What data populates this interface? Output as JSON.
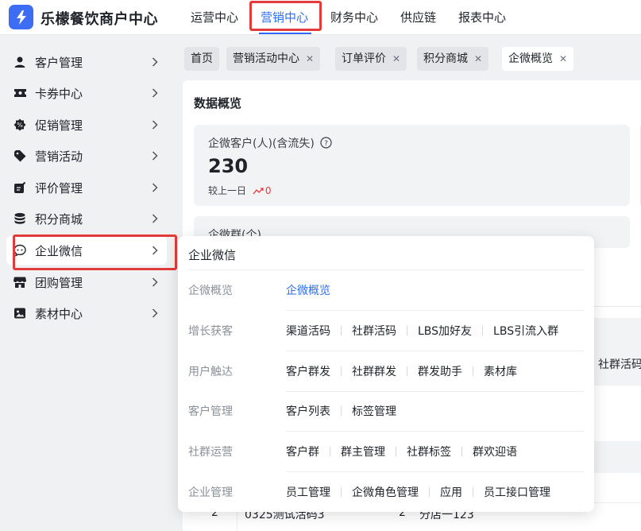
{
  "app": {
    "title": "乐檬餐饮商户中心",
    "accent": "#2f6cf6",
    "highlight": "#e23b3b"
  },
  "top_nav": [
    {
      "label": "运营中心",
      "active": false
    },
    {
      "label": "营销中心",
      "active": true
    },
    {
      "label": "财务中心",
      "active": false
    },
    {
      "label": "供应链",
      "active": false
    },
    {
      "label": "报表中心",
      "active": false
    }
  ],
  "sidebar": {
    "items": [
      {
        "label": "客户管理",
        "icon": "user-icon"
      },
      {
        "label": "卡券中心",
        "icon": "ticket-icon"
      },
      {
        "label": "促销管理",
        "icon": "gear-badge-icon"
      },
      {
        "label": "营销活动",
        "icon": "tag-icon"
      },
      {
        "label": "评价管理",
        "icon": "review-icon"
      },
      {
        "label": "积分商城",
        "icon": "coins-icon"
      },
      {
        "label": "企业微信",
        "icon": "chat-icon",
        "active": true
      },
      {
        "label": "团购管理",
        "icon": "store-icon"
      },
      {
        "label": "素材中心",
        "icon": "image-icon"
      }
    ]
  },
  "tabs": [
    {
      "label": "首页",
      "closable": false
    },
    {
      "label": "营销活动中心",
      "closable": true
    },
    {
      "label": "订单评价",
      "closable": true
    },
    {
      "label": "积分商城",
      "closable": true
    },
    {
      "label": "企微概览",
      "closable": true,
      "active": true
    }
  ],
  "overview": {
    "title": "数据概览",
    "customers": {
      "label": "企微客户(人)(含流失)",
      "value": "230",
      "compare_label": "较上一日",
      "delta": "0"
    },
    "groups": {
      "label": "企微群(个)"
    }
  },
  "background": {
    "right_text": "社群活码",
    "row_index": "2",
    "row_name": "0325测试活码3",
    "row_count": "2",
    "row_store": "分店一123"
  },
  "popup": {
    "title": "企业微信",
    "groups": [
      {
        "name": "企微概览",
        "items": [
          {
            "label": "企微概览",
            "link": true
          }
        ]
      },
      {
        "name": "增长获客",
        "items": [
          {
            "label": "渠道活码"
          },
          {
            "label": "社群活码"
          },
          {
            "label": "LBS加好友"
          },
          {
            "label": "LBS引流入群"
          }
        ]
      },
      {
        "name": "用户触达",
        "items": [
          {
            "label": "客户群发"
          },
          {
            "label": "社群群发"
          },
          {
            "label": "群发助手"
          },
          {
            "label": "素材库"
          }
        ]
      },
      {
        "name": "客户管理",
        "items": [
          {
            "label": "客户列表"
          },
          {
            "label": "标签管理"
          }
        ]
      },
      {
        "name": "社群运营",
        "items": [
          {
            "label": "客户群"
          },
          {
            "label": "群主管理"
          },
          {
            "label": "社群标签"
          },
          {
            "label": "群欢迎语"
          }
        ]
      },
      {
        "name": "企业管理",
        "items": [
          {
            "label": "员工管理"
          },
          {
            "label": "企微角色管理"
          },
          {
            "label": "应用"
          },
          {
            "label": "员工接口管理"
          }
        ]
      }
    ]
  }
}
